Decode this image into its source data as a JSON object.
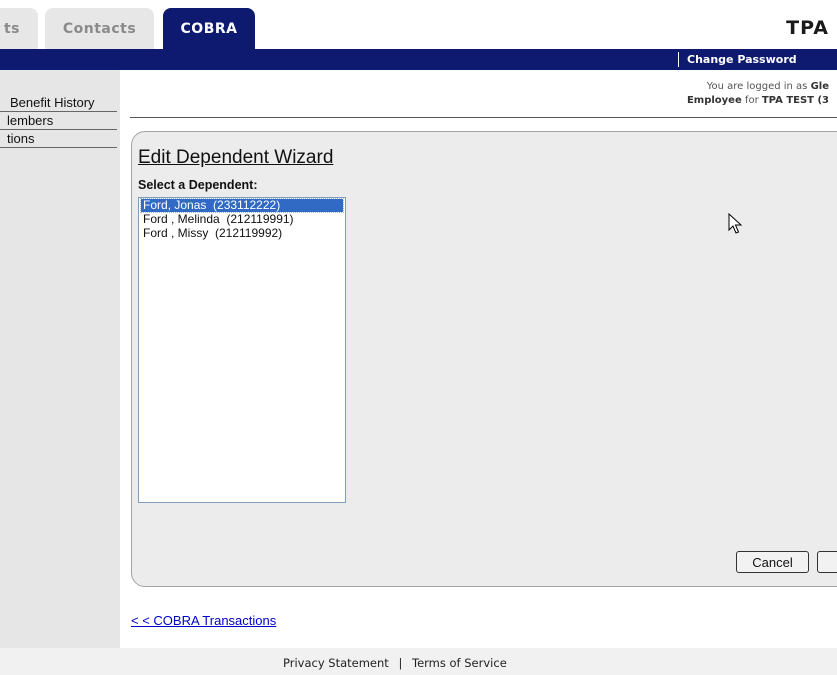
{
  "tabs": [
    {
      "label": "ts"
    },
    {
      "label": "Contacts"
    },
    {
      "label": "COBRA",
      "active": true
    }
  ],
  "brand": "TPA",
  "topbar": {
    "change_password": "Change Password"
  },
  "sidebar": {
    "items": [
      {
        "label": "Benefit History"
      },
      {
        "label": "lembers"
      },
      {
        "label": "tions"
      }
    ]
  },
  "login_info": {
    "prefix": "You are logged in as ",
    "user": "Gle",
    "role": "Employee",
    "for_text": " for ",
    "org": "TPA TEST (3"
  },
  "wizard": {
    "title": "Edit Dependent Wizard",
    "select_label": "Select a Dependent:",
    "dependents": [
      {
        "text": "Ford, Jonas  (233112222)",
        "selected": true
      },
      {
        "text": "Ford , Melinda  (212119991)",
        "selected": false
      },
      {
        "text": "Ford , Missy  (212119992)",
        "selected": false
      }
    ],
    "cancel_label": "Cancel",
    "next_label": ""
  },
  "back_link": "< < COBRA Transactions",
  "footer": {
    "privacy": "Privacy Statement",
    "separator": "|",
    "terms": "Terms of Service"
  },
  "colors": {
    "navy": "#0d1a6f",
    "selection": "#316ac5",
    "link": "#0000cc"
  }
}
